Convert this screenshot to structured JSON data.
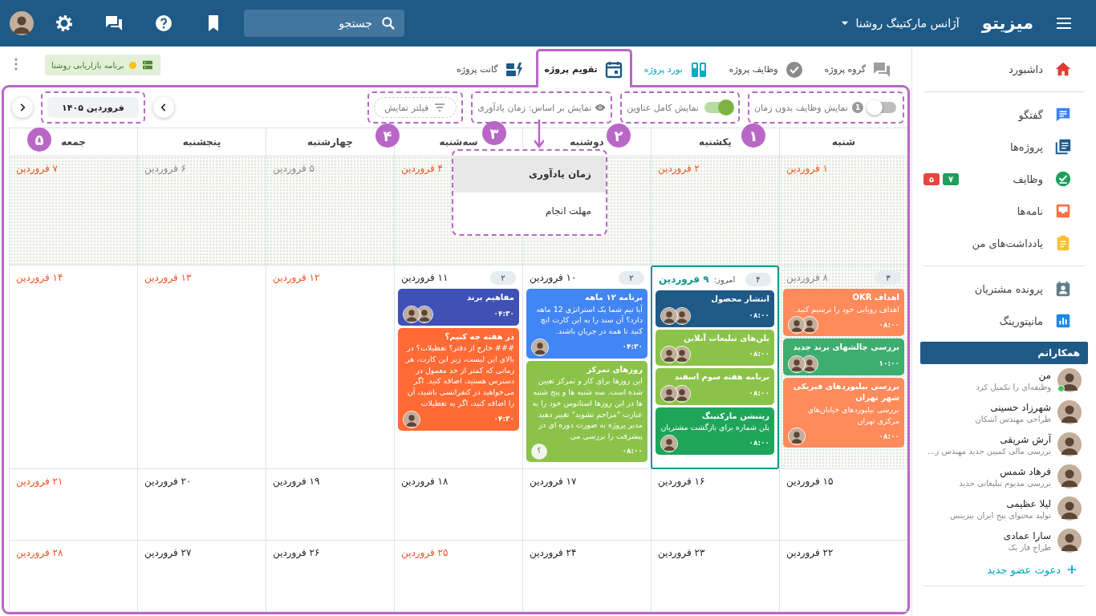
{
  "topbar": {
    "logo": "میزیتو",
    "workspace": "آژانس مارکتینگ روشنا",
    "search": {
      "placeholder": "جستجو"
    }
  },
  "sidebar": {
    "nav_groups": [
      [
        {
          "label": "داشبورد"
        }
      ],
      [
        {
          "label": "گفتگو"
        },
        {
          "label": "پروژه‌ها"
        },
        {
          "label": "وظایف",
          "badges": [
            {
              "text": "۷",
              "color": "#1e9e5a"
            },
            {
              "text": "۵",
              "color": "#e8453c"
            }
          ]
        },
        {
          "label": "نامه‌ها"
        },
        {
          "label": "یادداشت‌های من"
        }
      ],
      [
        {
          "label": "پرونده مشتریان"
        },
        {
          "label": "مانیتورینگ"
        }
      ]
    ],
    "team": {
      "title": "همکارانم",
      "members": [
        {
          "name": "من",
          "status": "وظیفه‌ای را تکمیل کرد",
          "online": true
        },
        {
          "name": "شهرزاد حسینی",
          "status": "طراحی مهندس اشکان",
          "online": false
        },
        {
          "name": "آرش شریفی",
          "status": "بررسی مالی کمپین جدید مهندس ز...",
          "online": false
        },
        {
          "name": "فرهاد شمس",
          "status": "بررسی مدیوم تبلیغاتی جدید",
          "online": false
        },
        {
          "name": "لیلا عظیمی",
          "status": "تولید محتوای پیج ایران بیزینس",
          "online": false
        },
        {
          "name": "سارا عمادی",
          "status": "طراح فاز یک",
          "online": false
        }
      ],
      "invite": "دعوت عضو جدید"
    }
  },
  "tabs": [
    {
      "label": "گروه پروژه",
      "selected": false,
      "highlighted": false
    },
    {
      "label": "وظایف پروژه",
      "selected": false,
      "highlighted": false
    },
    {
      "label": "بورد پروژه",
      "selected": false,
      "highlighted": true
    },
    {
      "label": "تقویم پروژه",
      "selected": true,
      "highlighted": false
    },
    {
      "label": "گانت پروژه",
      "selected": false,
      "highlighted": false
    }
  ],
  "project_tag": {
    "label": "برنامه بازاریابی روشنا"
  },
  "toolbar": {
    "toggles": [
      {
        "label": "نمایش وظایف بدون زمان",
        "on": false,
        "count": "1"
      },
      {
        "label": "نمایش کامل عناوین",
        "on": true
      }
    ],
    "view_by": "نمایش بر اساس: زمان یادآوری",
    "filter": "فیلتر نمایش",
    "month": "فروردین ۱۴۰۵"
  },
  "view_menu": {
    "options": [
      {
        "label": "زمان یادآوری",
        "selected": true
      },
      {
        "label": "مهلت انجام",
        "selected": false
      }
    ]
  },
  "annotations": [
    "۱",
    "۲",
    "۳",
    "۴",
    "۵"
  ],
  "calendar": {
    "weekdays": [
      "شنبه",
      "یکشنبه",
      "دوشنبه",
      "سه‌شنبه",
      "چهارشنبه",
      "پنجشنبه",
      "جمعه"
    ],
    "weeks": [
      [
        {
          "date": "۱ فروردین",
          "holiday": true,
          "past": true
        },
        {
          "date": "۲ فروردین",
          "holiday": true,
          "past": true
        },
        {
          "past": true
        },
        {
          "date": "۴ فروردین",
          "holiday": true,
          "past": true
        },
        {
          "date": "۵ فروردین",
          "holiday": false,
          "past": true
        },
        {
          "date": "۶ فروردین",
          "holiday": false,
          "past": true
        },
        {
          "date": "۷ فروردین",
          "holiday": true,
          "past": true
        }
      ],
      [
        {
          "date": "۸ فروردین",
          "holiday": false,
          "past": true,
          "count": "۳",
          "cards": [
            {
              "title": "اهداف OKR",
              "description": "اهداف رویایی خود را ترسیم کنید.",
              "time": "۰۸:۰۰",
              "color": "#ff8a5b"
            },
            {
              "title": "بررسی چالشهای برند جدید",
              "time": "۱۰:۰۰",
              "color": "#3dae6f"
            },
            {
              "title": "بررسی بیلبوردهای فیزیکی شهر تهران",
              "description": "بررسی بیلبوردهای خیابان‌های مرکزی تهران",
              "time": "۰۸:۰۰",
              "color": "#ff8a5b"
            }
          ]
        },
        {
          "date": "۹ فروردین",
          "today_label": "امروز:",
          "holiday": false,
          "past": false,
          "today": true,
          "count": "۴",
          "cards": [
            {
              "title": "انتشار محصول",
              "time": "۰۸:۰۰",
              "color": "#1f5a87"
            },
            {
              "title": "پلن‌های تبلیغات آنلاین",
              "time": "۰۸:۰۰",
              "color": "#8bc34a"
            },
            {
              "title": "برنامه هفته سوم اسفند",
              "time": "۰۸:۰۰",
              "color": "#8bc34a"
            },
            {
              "title": "ریتنشن مارکتینگ",
              "description": "پلن شماره برای بازگشت مشتریان",
              "time": "۰۸:۰۰",
              "color": "#1ea55a"
            }
          ]
        },
        {
          "date": "۱۰ فروردین",
          "holiday": false,
          "past": false,
          "count": "۲",
          "cards": [
            {
              "title": "برنامه ۱۲ ماهه",
              "description": "آیا تیم شما یک استراتژی 12 ماهه دارد؟ آن سند را به این کارت اتچ کنید تا همه در جریان باشند.",
              "time": "۰۴:۳۰",
              "color": "#4285f4"
            },
            {
              "title": "روزهای تمرکز",
              "description": "این روزها برای کار و تمرکز تعیین شده است. سه شنبه ها و پنج شنبه ها در این روزها استاتوس خود را به عبارت \"مزاحم نشوید\" تغییر دهید مدیر پروژه به صورت دوره ای در پیشرفت را بررسی می",
              "time": "۰۸:۰۰",
              "color": "#8bc34a",
              "avatars": [
                {
                  "kind": "unknown",
                  "label": "؟"
                }
              ]
            }
          ]
        },
        {
          "date": "۱۱ فروردین",
          "holiday": false,
          "past": false,
          "count": "۲",
          "cards": [
            {
              "title": "مفاهیم برند",
              "time": "۰۴:۳۰",
              "color": "#3f51b5"
            },
            {
              "title": "در هفته چه کنیم؟",
              "description": "### خارج از دفتر؟ تعطیلات؟ در بالای این لیست، زیر این کارت، هر زمانی که کمتر از حد معمول در دسترس هستید، اضافه کنید. اگر می‌خواهید در کنفرانسی باشید، آن را اضافه کنید، اگر به تعطیلات",
              "time": "۰۴:۳۰",
              "color": "#ff6a35"
            }
          ]
        },
        {
          "date": "۱۲ فروردین",
          "holiday": true,
          "past": false
        },
        {
          "date": "۱۳ فروردین",
          "holiday": true,
          "past": false
        },
        {
          "date": "۱۴ فروردین",
          "holiday": true,
          "past": false
        }
      ],
      [
        {
          "date": "۱۵ فروردین",
          "holiday": false,
          "past": false
        },
        {
          "date": "۱۶ فروردین",
          "holiday": false,
          "past": false
        },
        {
          "date": "۱۷ فروردین",
          "holiday": false,
          "past": false
        },
        {
          "date": "۱۸ فروردین",
          "holiday": false,
          "past": false
        },
        {
          "date": "۱۹ فروردین",
          "holiday": false,
          "past": false
        },
        {
          "date": "۲۰ فروردین",
          "holiday": false,
          "past": false
        },
        {
          "date": "۲۱ فروردین",
          "holiday": true,
          "past": false
        }
      ],
      [
        {
          "date": "۲۲ فروردین",
          "holiday": false,
          "past": false
        },
        {
          "date": "۲۳ فروردین",
          "holiday": false,
          "past": false
        },
        {
          "date": "۲۴ فروردین",
          "holiday": false,
          "past": false
        },
        {
          "date": "۲۵ فروردین",
          "holiday": true,
          "past": false
        },
        {
          "date": "۲۶ فروردین",
          "holiday": false,
          "past": false
        },
        {
          "date": "۲۷ فروردین",
          "holiday": false,
          "past": false
        },
        {
          "date": "۲۸ فروردین",
          "holiday": true,
          "past": false
        }
      ]
    ]
  }
}
